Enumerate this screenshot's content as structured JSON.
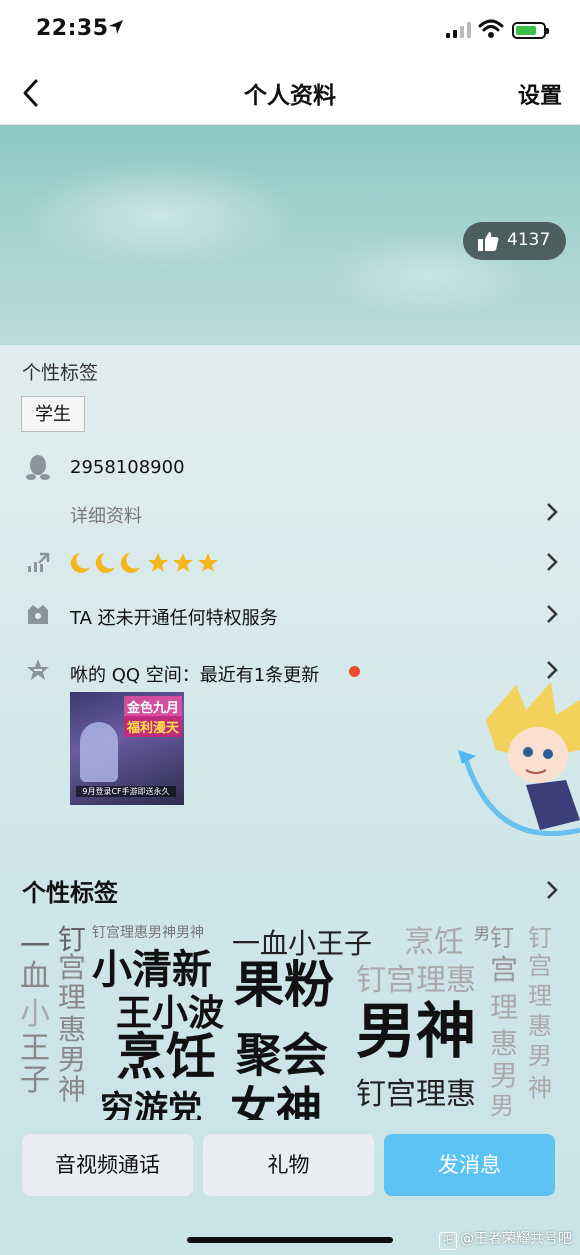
{
  "status_bar": {
    "time": "22:35"
  },
  "nav": {
    "title": "个人资料",
    "settings_label": "设置"
  },
  "cover": {
    "likes": "4137"
  },
  "tags_section": {
    "label": "个性标签",
    "tags": [
      "学生"
    ]
  },
  "rows": {
    "qq_number": "2958108900",
    "detail_label": "详细资料",
    "level_icons": "🌙🌙🌙⭐⭐⭐",
    "privilege_text": "TA 还未开通任何特权服务",
    "qzone_text": "咻的 QQ 空间：最近有1条更新"
  },
  "thumbnail": {
    "line1": "金色九月",
    "line2": "福利漫天",
    "line3": "9月登录CF手游即送永久"
  },
  "word_cloud": {
    "title": "个性标签",
    "words": [
      {
        "t": "一",
        "s": 30,
        "c": "#666"
      },
      {
        "t": "钉",
        "s": 28,
        "c": "#666"
      },
      {
        "t": "钉宫理惠男神男神",
        "s": 14,
        "c": "#777"
      },
      {
        "t": "一血小王子",
        "s": 28,
        "c": "#222"
      },
      {
        "t": "烹饪",
        "s": 30,
        "c": "#aaa"
      },
      {
        "t": "男",
        "s": 16,
        "c": "#888"
      },
      {
        "t": "钉",
        "s": 24,
        "c": "#999"
      },
      {
        "t": "钉",
        "s": 24,
        "c": "#aaa"
      },
      {
        "t": "血",
        "s": 30,
        "c": "#888"
      },
      {
        "t": "宫",
        "s": 28,
        "c": "#888"
      },
      {
        "t": "小清新",
        "s": 40,
        "c": "#111"
      },
      {
        "t": "果粉",
        "s": 50,
        "c": "#111"
      },
      {
        "t": "钉宫理惠",
        "s": 30,
        "c": "#aaa"
      },
      {
        "t": "宫",
        "s": 28,
        "c": "#999"
      },
      {
        "t": "宫",
        "s": 24,
        "c": "#aaa"
      },
      {
        "t": "小",
        "s": 30,
        "c": "#aaa"
      },
      {
        "t": "理",
        "s": 28,
        "c": "#888"
      },
      {
        "t": "王小波",
        "s": 36,
        "c": "#111"
      },
      {
        "t": "理",
        "s": 28,
        "c": "#aaa"
      },
      {
        "t": "理",
        "s": 24,
        "c": "#aaa"
      },
      {
        "t": "王",
        "s": 30,
        "c": "#888"
      },
      {
        "t": "惠",
        "s": 28,
        "c": "#888"
      },
      {
        "t": "男神",
        "s": 60,
        "c": "#111"
      },
      {
        "t": "惠",
        "s": 28,
        "c": "#aaa"
      },
      {
        "t": "惠",
        "s": 24,
        "c": "#aaa"
      },
      {
        "t": "子",
        "s": 30,
        "c": "#888"
      },
      {
        "t": "男",
        "s": 28,
        "c": "#888"
      },
      {
        "t": "烹饪",
        "s": 50,
        "c": "#111"
      },
      {
        "t": "聚会",
        "s": 46,
        "c": "#111"
      },
      {
        "t": "男",
        "s": 28,
        "c": "#aaa"
      },
      {
        "t": "男",
        "s": 24,
        "c": "#aaa"
      },
      {
        "t": "神",
        "s": 28,
        "c": "#888"
      },
      {
        "t": "钉宫理惠",
        "s": 30,
        "c": "#222"
      },
      {
        "t": "神",
        "s": 24,
        "c": "#aaa"
      },
      {
        "t": "穷游党",
        "s": 34,
        "c": "#111"
      },
      {
        "t": "女神",
        "s": 46,
        "c": "#111"
      },
      {
        "t": "男",
        "s": 24,
        "c": "#aaa"
      }
    ]
  },
  "bottom_bar": {
    "call": "音视频通话",
    "gift": "礼物",
    "message": "发消息"
  },
  "watermark": {
    "text": "@王者荣耀共号吧"
  }
}
